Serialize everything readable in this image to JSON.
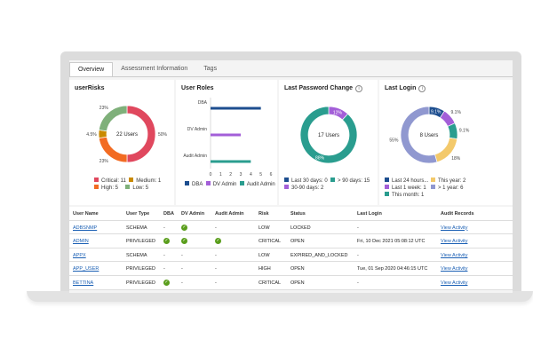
{
  "tabs": [
    "Overview",
    "Assessment Information",
    "Tags"
  ],
  "user_risks": {
    "title": "userRisks",
    "center": "22 Users",
    "slices": [
      {
        "label": "Critical",
        "value": 11,
        "pct": "50%",
        "color": "#e0485e"
      },
      {
        "label": "High",
        "value": 5,
        "pct": "23%",
        "color": "#f26b22"
      },
      {
        "label": "Medium",
        "value": 1,
        "pct": "4.5%",
        "color": "#c98a00"
      },
      {
        "label": "Low",
        "value": 5,
        "pct": "23%",
        "color": "#7fb07a"
      }
    ],
    "legend": [
      "Critical: 11",
      "Medium: 1",
      "High: 5",
      "Low: 5"
    ]
  },
  "user_roles": {
    "title": "User Roles",
    "categories": [
      "DBA",
      "DV Admin",
      "Audit Admin"
    ],
    "values": [
      5,
      3,
      4
    ],
    "colors": [
      "#1d4e8f",
      "#a35fd8",
      "#2a9d8f"
    ],
    "ticks": [
      "0",
      "1",
      "2",
      "3",
      "4",
      "5",
      "6"
    ],
    "xlim": [
      0,
      6
    ],
    "legend": [
      "DBA",
      "DV Admin",
      "Audit Admin"
    ]
  },
  "password": {
    "title": "Last Password Change",
    "info_icon": "info-icon",
    "center": "17 Users",
    "slices": [
      {
        "label": "Last 30 days",
        "value": 0,
        "pct": "",
        "color": "#1d4e8f"
      },
      {
        "label": "30-90 days",
        "value": 2,
        "pct": "12%",
        "color": "#a35fd8"
      },
      {
        "label": "> 90 days",
        "value": 15,
        "pct": "88%",
        "color": "#2a9d8f"
      }
    ],
    "legend": [
      "Last 30 days: 0",
      "> 90 days: 15",
      "30-90 days: 2"
    ]
  },
  "login": {
    "title": "Last Login",
    "info_icon": "info-icon",
    "center": "8 Users",
    "slices": [
      {
        "label": "Last 24 hours",
        "value": 1,
        "pct": "9.1%",
        "color": "#1d4e8f"
      },
      {
        "label": "Last 1 week",
        "value": 1,
        "pct": "9.1%",
        "color": "#a35fd8"
      },
      {
        "label": "This month",
        "value": 1,
        "pct": "9.1%",
        "color": "#2a9d8f"
      },
      {
        "label": "This year",
        "value": 2,
        "pct": "18%",
        "color": "#f3c96b"
      },
      {
        "label": "> 1 year",
        "value": 6,
        "pct": "55%",
        "color": "#9098d0"
      }
    ],
    "legend": [
      "Last 24 hours...",
      "This year: 2",
      "Last 1 week: 1",
      "> 1 year: 6",
      "This month: 1"
    ]
  },
  "table": {
    "headers": [
      "User Name",
      "User Type",
      "DBA",
      "DV Admin",
      "Audit Admin",
      "Risk",
      "Status",
      "Last Login",
      "Audit Records"
    ],
    "rows": [
      [
        "ADBSNMP",
        "SCHEMA",
        "-",
        "check",
        "-",
        "LOW",
        "LOCKED",
        "-",
        "View Activity"
      ],
      [
        "ADMIN",
        "PRIVILEGED",
        "check",
        "check",
        "check",
        "CRITICAL",
        "OPEN",
        "Fri, 10 Dec 2021 05:08:12 UTC",
        "View Activity"
      ],
      [
        "APPX",
        "SCHEMA",
        "-",
        "-",
        "-",
        "LOW",
        "EXPIRED_AND_LOCKED",
        "-",
        "View Activity"
      ],
      [
        "APP_USER",
        "PRIVILEGED",
        "-",
        "-",
        "-",
        "HIGH",
        "OPEN",
        "Tue, 01 Sep 2020 04:46:15 UTC",
        "View Activity"
      ],
      [
        "BETTINA",
        "PRIVILEGED",
        "check",
        "-",
        "-",
        "CRITICAL",
        "OPEN",
        "-",
        "View Activity"
      ]
    ]
  }
}
